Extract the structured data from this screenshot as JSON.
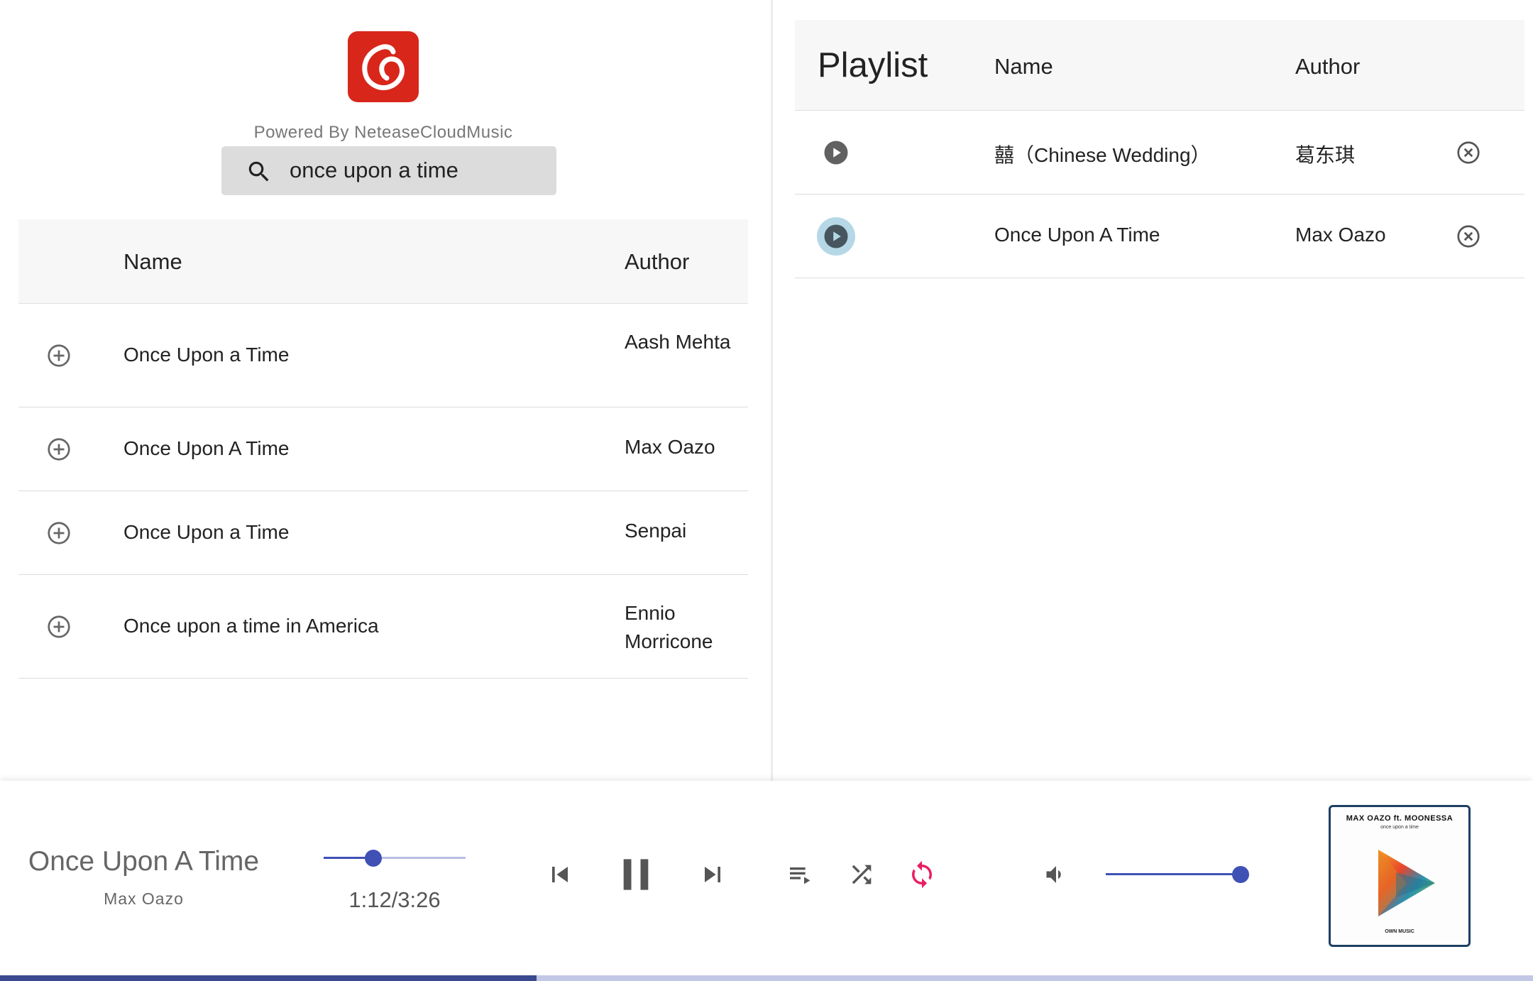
{
  "app": {
    "powered_by": "Powered By NeteaseCloudMusic",
    "brand_color": "#d8261b",
    "accent_color": "#3f51b5",
    "active_color": "#e91e63"
  },
  "search": {
    "value": "once upon a time",
    "placeholder": "Search",
    "icon": "search-icon"
  },
  "results": {
    "header": {
      "name": "Name",
      "author": "Author"
    },
    "rows": [
      {
        "name": "Once Upon a Time",
        "author": "Aash Mehta",
        "icon": "add-circle-icon"
      },
      {
        "name": "Once Upon A Time",
        "author": "Max Oazo",
        "icon": "add-circle-icon"
      },
      {
        "name": "Once Upon a Time",
        "author": "Senpai",
        "icon": "add-circle-icon"
      },
      {
        "name": "Once upon a time in America",
        "author": "Ennio Morricone",
        "icon": "add-circle-icon"
      }
    ]
  },
  "playlist": {
    "title": "Playlist",
    "header": {
      "name": "Name",
      "author": "Author"
    },
    "rows": [
      {
        "name": "囍（Chinese Wedding）",
        "author": "葛东琪",
        "active": false
      },
      {
        "name": "Once Upon A Time",
        "author": "Max Oazo",
        "active": true
      }
    ]
  },
  "player": {
    "title": "Once Upon A Time",
    "artist": "Max Oazo",
    "time": "1:12/3:26",
    "progress_fraction": 0.35,
    "volume_fraction": 1.0,
    "repeat_active": true,
    "controls": [
      "skip-previous-icon",
      "pause-icon",
      "skip-next-icon",
      "queue-music-icon",
      "shuffle-icon",
      "repeat-icon",
      "volume-icon"
    ],
    "album_art": {
      "line1": "MAX OAZO ft. MOONESSA",
      "line2": "once upon a time",
      "label": "OWN MUSIC"
    }
  }
}
